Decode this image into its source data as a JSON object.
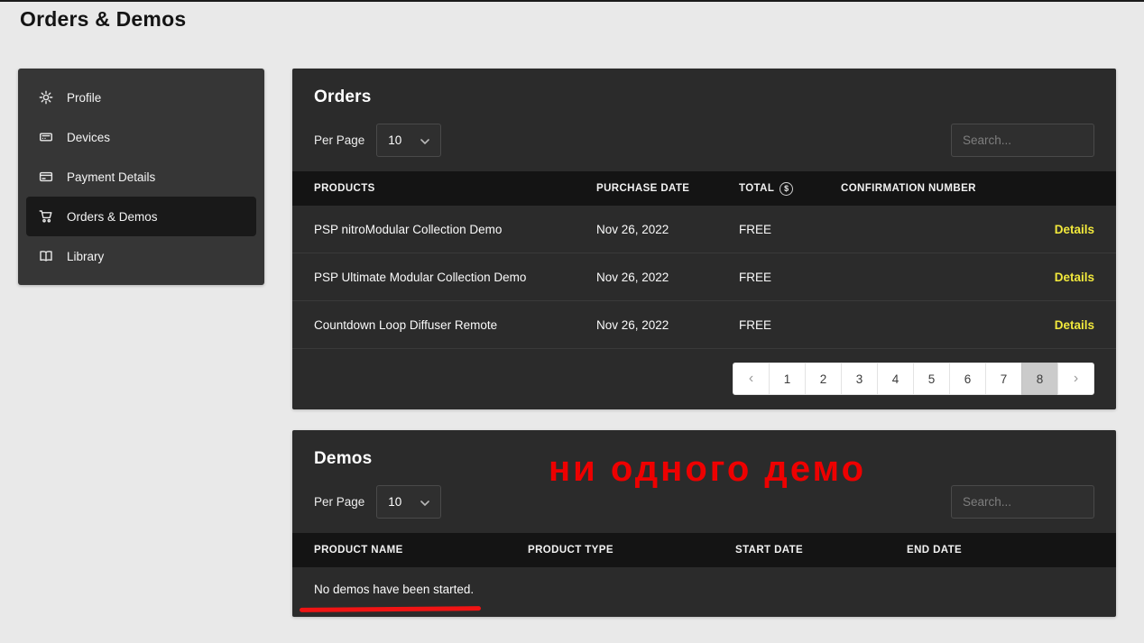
{
  "page": {
    "title": "Orders & Demos"
  },
  "sidebar": {
    "items": [
      {
        "label": "Profile"
      },
      {
        "label": "Devices"
      },
      {
        "label": "Payment Details"
      },
      {
        "label": "Orders & Demos",
        "active": true
      },
      {
        "label": "Library"
      }
    ]
  },
  "orders": {
    "title": "Orders",
    "per_page_label": "Per Page",
    "per_page_value": "10",
    "search_placeholder": "Search...",
    "columns": {
      "products": "PRODUCTS",
      "purchase_date": "PURCHASE DATE",
      "total": "TOTAL",
      "total_icon": "$",
      "confirmation_number": "CONFIRMATION NUMBER"
    },
    "rows": [
      {
        "product": "PSP nitroModular Collection Demo",
        "purchase_date": "Nov 26, 2022",
        "total": "FREE",
        "confirmation_number": "",
        "details_label": "Details"
      },
      {
        "product": "PSP Ultimate Modular Collection Demo",
        "purchase_date": "Nov 26, 2022",
        "total": "FREE",
        "confirmation_number": "",
        "details_label": "Details"
      },
      {
        "product": "Countdown Loop Diffuser Remote",
        "purchase_date": "Nov 26, 2022",
        "total": "FREE",
        "confirmation_number": "",
        "details_label": "Details"
      }
    ],
    "pagination": {
      "prev": "‹",
      "pages": [
        "1",
        "2",
        "3",
        "4",
        "5",
        "6",
        "7",
        "8"
      ],
      "active_page": "8",
      "next": "›"
    }
  },
  "demos": {
    "title": "Demos",
    "per_page_label": "Per Page",
    "per_page_value": "10",
    "search_placeholder": "Search...",
    "columns": {
      "product_name": "PRODUCT NAME",
      "product_type": "PRODUCT TYPE",
      "start_date": "START DATE",
      "end_date": "END DATE"
    },
    "empty_message": "No demos have been started."
  },
  "annotations": {
    "demos_note": "ни одного демо"
  },
  "colors": {
    "panel_bg": "#2b2b2b",
    "table_header_bg": "#141414",
    "details_link": "#f2e93c",
    "annotation_red": "#ee0000",
    "pagination_active_bg": "#cbcbcb"
  }
}
